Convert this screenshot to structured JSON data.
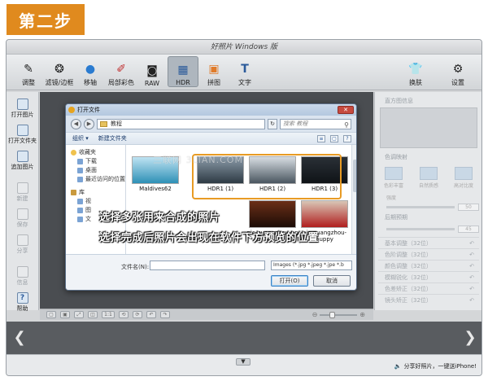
{
  "step_badge": "第二步",
  "app": {
    "title": "好照片 Windows 版",
    "toolbar": [
      {
        "label": "调整",
        "icon": "pencil-icon"
      },
      {
        "label": "滤镜/边框",
        "icon": "filter-icon"
      },
      {
        "label": "移轴",
        "icon": "drop-icon"
      },
      {
        "label": "局部彩色",
        "icon": "brush-icon"
      },
      {
        "label": "RAW",
        "icon": "camera-icon"
      },
      {
        "label": "HDR",
        "icon": "hdr-icon",
        "active": true
      },
      {
        "label": "拼图",
        "icon": "collage-icon"
      },
      {
        "label": "文字",
        "icon": "text-icon"
      }
    ],
    "toolbar_right": [
      {
        "label": "换肤",
        "icon": "shirt-icon"
      },
      {
        "label": "设置",
        "icon": "gear-icon"
      }
    ],
    "sidebar": [
      {
        "label": "打开图片",
        "enabled": true
      },
      {
        "label": "打开文件夹",
        "enabled": true
      },
      {
        "label": "追加图片",
        "enabled": true
      },
      {
        "label": "新建",
        "enabled": false
      },
      {
        "label": "保存",
        "enabled": false
      },
      {
        "label": "分享",
        "enabled": false
      },
      {
        "label": "信息",
        "enabled": false
      },
      {
        "label": "帮助",
        "enabled": true
      }
    ],
    "right_panel": {
      "header": "直方图信息",
      "section_tone": "色调映射",
      "effects": [
        "色彩丰富",
        "自然质感",
        "高对比度"
      ],
      "slider_intensity_label": "强度",
      "slider_intensity_value": "50",
      "section_exposure": "后期预期",
      "slider_exposure_value": "45",
      "rows": [
        "基本调整（32位）",
        "色阶调整（32位）",
        "颜色调整（32位）",
        "模糊锐化（32位）",
        "色差矫正（32位）",
        "镜头矫正（32位）"
      ]
    },
    "bottom_toolbar": {
      "zoom_label": "1:1"
    },
    "status": {
      "share_text": "分享好照片，一键送iPhone!"
    }
  },
  "dialog": {
    "title": "打开文件",
    "close": "✕",
    "address": "教程",
    "search_placeholder": "搜索 教程",
    "toolbar": {
      "organize": "组织 ▾",
      "new_folder": "新建文件夹"
    },
    "nav_items": [
      {
        "label": "收藏夹",
        "kind": "star",
        "level": 0
      },
      {
        "label": "下载",
        "kind": "folder",
        "level": 1
      },
      {
        "label": "桌面",
        "kind": "folder",
        "level": 1
      },
      {
        "label": "最近访问的位置",
        "kind": "folder",
        "level": 1
      },
      {
        "label": "库",
        "kind": "lib",
        "level": 0
      },
      {
        "label": "视",
        "kind": "folder",
        "level": 1
      },
      {
        "label": "图",
        "kind": "folder",
        "level": 1
      },
      {
        "label": "文",
        "kind": "folder",
        "level": 1
      }
    ],
    "files": [
      {
        "name": "Maldives62",
        "colors": [
          "#bfe3f2",
          "#2e90b6"
        ]
      },
      {
        "name": "HDR1 (1)",
        "colors": [
          "#8a9aa8",
          "#2e3a44"
        ]
      },
      {
        "name": "HDR1 (2)",
        "colors": [
          "#d7dde2",
          "#4a5660"
        ]
      },
      {
        "name": "HDR1 (3)",
        "colors": [
          "#2a3036",
          "#0f1317"
        ]
      },
      {
        "name": "pic-guangzhou-pp",
        "colors": [
          "#6b2f18",
          "#1c0c06"
        ]
      },
      {
        "name": "pic-guangzhou-puppy",
        "colors": [
          "#d9c6b6",
          "#b01e1e"
        ]
      }
    ],
    "filename_label": "文件名(N):",
    "filename_value": "",
    "filetype_value": "Images (*.jpg *.jpeg *.jpe *.b",
    "open_button": "打开(O)",
    "cancel_button": "取消"
  },
  "annotations": {
    "line1": "选择多张用来合成的照片",
    "line2": "选择完成后照片会出现在软件下方预览的位置"
  },
  "watermark": "三联网 3LIAN.COM"
}
